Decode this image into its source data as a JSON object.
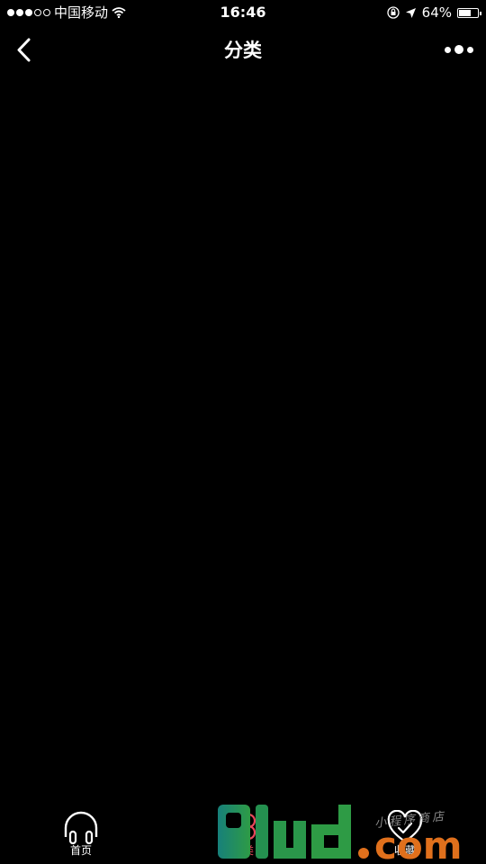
{
  "status_bar": {
    "carrier": "中国移动",
    "time": "16:46",
    "battery_percent": "64%",
    "battery_level": 0.64,
    "signal_bars_filled": 3,
    "signal_bars_total": 5,
    "icons": [
      "wifi-icon",
      "lock-rotation-icon",
      "location-arrow-icon",
      "battery-icon"
    ]
  },
  "nav_bar": {
    "title": "分类",
    "back_icon": "chevron-left-icon",
    "more_icon": "more-dots-icon"
  },
  "tab_bar": {
    "tabs": [
      {
        "label": "首页",
        "icon": "headphones-icon",
        "active": false
      },
      {
        "label": "分类",
        "icon": "clover-icon",
        "active": true
      },
      {
        "label": "收藏",
        "icon": "heart-check-icon",
        "active": false
      }
    ],
    "active_color": "#e8475a",
    "inactive_color": "#ffffff"
  },
  "watermark": {
    "text": "9lud.com",
    "sub_text": "小程序商店",
    "colors": {
      "nine": "#1a8f7a",
      "lud": "#2e9b45",
      "dot_com": "#e0701c"
    }
  },
  "colors": {
    "background": "#000000",
    "text": "#ffffff"
  }
}
